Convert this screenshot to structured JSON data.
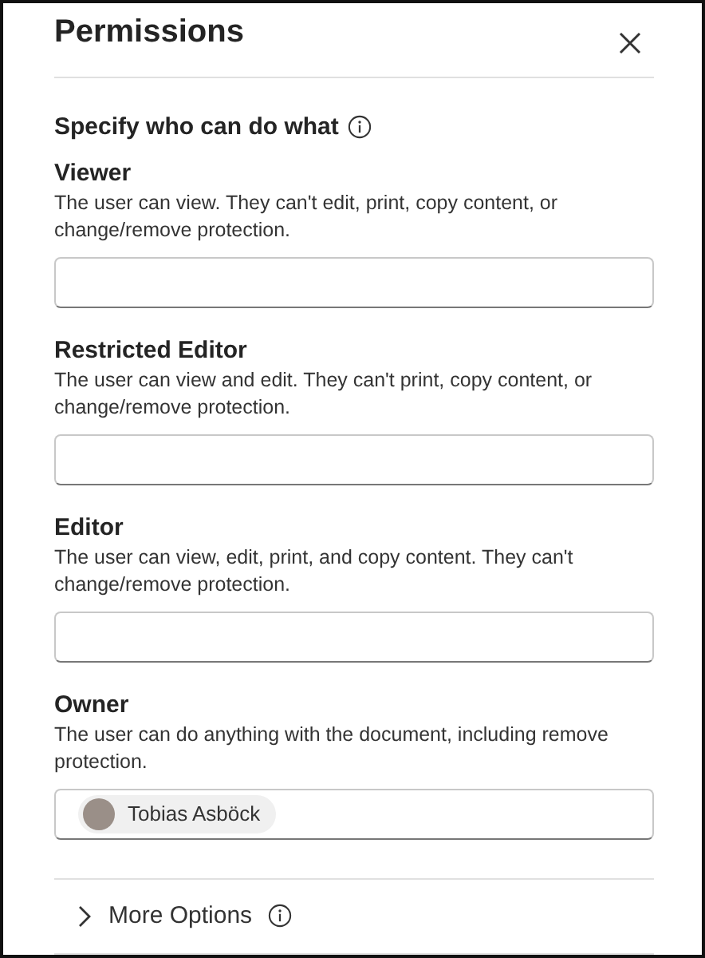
{
  "panel": {
    "title": "Permissions"
  },
  "section": {
    "heading": "Specify who can do what"
  },
  "roles": [
    {
      "name": "Viewer",
      "description": "The user can view. They can't edit, print, copy content, or change/remove protection."
    },
    {
      "name": "Restricted Editor",
      "description": "The user can view and edit. They can't print, copy content, or change/remove protection."
    },
    {
      "name": "Editor",
      "description": "The user can view, edit, print, and copy content. They can't change/remove protection."
    },
    {
      "name": "Owner",
      "description": "The user can do anything with the document, including remove protection.",
      "people": [
        {
          "name": "Tobias Asböck"
        }
      ]
    }
  ],
  "more_options": {
    "label": "More Options",
    "expanded": false
  }
}
